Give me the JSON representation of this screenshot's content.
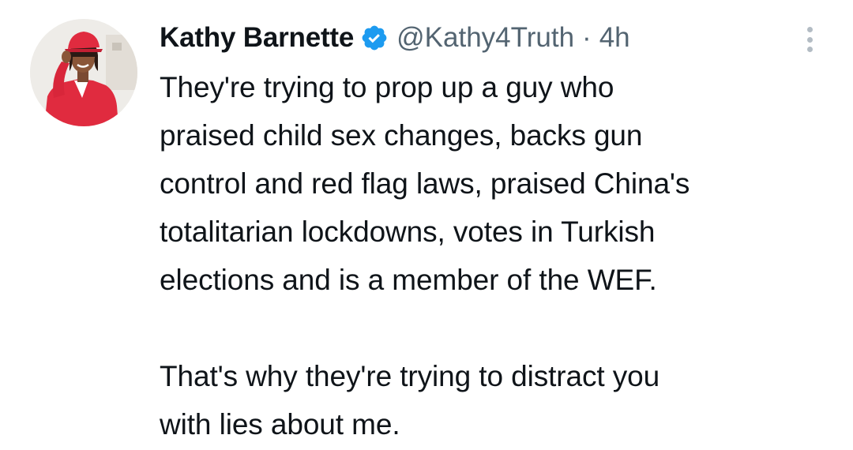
{
  "tweet": {
    "author": {
      "display_name": "Kathy Barnette",
      "handle": "@Kathy4Truth",
      "verified": true,
      "verified_icon": "verified-badge-icon",
      "avatar_icon": "profile-photo"
    },
    "separator": "·",
    "timestamp": "4h",
    "more_icon": "more-options-icon",
    "text_lines": [
      "They're trying to prop up a guy who",
      "praised child sex changes, backs gun",
      "control and red flag laws, praised China's",
      "totalitarian lockdowns, votes in Turkish",
      "elections and is a member of the WEF.",
      "",
      "That's why they're trying to distract you",
      "with lies about me."
    ],
    "colors": {
      "text": "#0f1419",
      "secondary": "#536471",
      "verified": "#1d9bf0",
      "more_dots": "#b3bcc4"
    }
  }
}
